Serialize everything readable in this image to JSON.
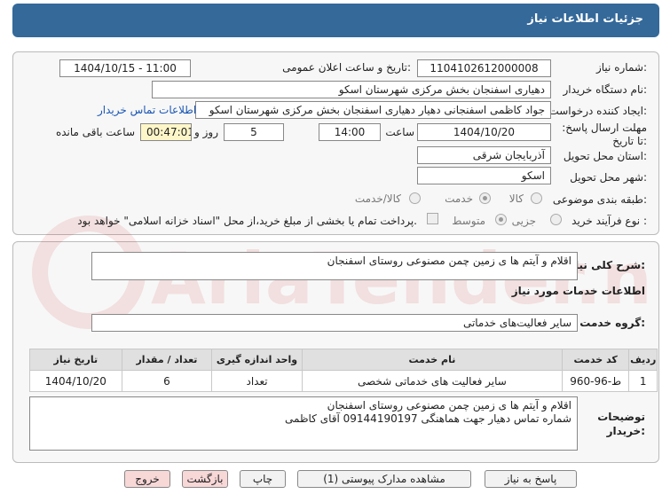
{
  "header": {
    "title": "جزئیات اطلاعات نیاز"
  },
  "fields": {
    "need_number_label": "شماره نیاز:",
    "need_number": "1104102612000008",
    "announce_label": "تاریخ و ساعت اعلان عمومی:",
    "announce_value": "1404/10/15 - 11:00",
    "buyer_label": "نام دستگاه خریدار:",
    "buyer_value": "دهیاری اسفنجان بخش مرکزی شهرستان اسکو",
    "creator_label": "ایجاد کننده درخواست:",
    "creator_value": "جواد کاظمی اسفنجانی دهیار دهیاری اسفنجان بخش مرکزی شهرستان اسکو",
    "contact_link": "اطلاعات تماس خریدار",
    "deadline_label": "مهلت ارسال پاسخ: تا تاریخ:",
    "deadline_date": "1404/10/20",
    "time_label": "ساعت",
    "deadline_time": "14:00",
    "days_value": "5",
    "days_label": "روز و",
    "remaining_time": "00:47:01",
    "remaining_label": "ساعت باقی مانده",
    "province_label": "استان محل تحویل:",
    "province_value": "آذربایجان شرقی",
    "city_label": "شهر محل تحویل:",
    "city_value": "اسکو",
    "category_label": "طبقه بندی موضوعی:",
    "category_options": [
      "کالا",
      "خدمت",
      "کالا/خدمت"
    ],
    "process_label": "نوع فرآیند خرید :",
    "process_options": [
      "جزیی",
      "متوسط"
    ],
    "process_note": "پرداخت تمام یا بخشی از مبلغ خرید،از محل \"اسناد خزانه اسلامی\" خواهد بود."
  },
  "section2": {
    "desc_label": "شرح کلی نیاز:",
    "desc_value": "اقلام و آیتم ها ی زمین چمن مصنوعی روستای اسفنجان",
    "services_title": "اطلاعات خدمات مورد نیاز",
    "group_label": "گروه خدمت:",
    "group_value": "سایر فعالیت‌های خدماتی",
    "table_headers": [
      "ردیف",
      "کد خدمت",
      "نام خدمت",
      "واحد اندازه گیری",
      "تعداد / مقدار",
      "تاریخ نیاز"
    ],
    "rows": [
      [
        "1",
        "ط-96-960",
        "سایر فعالیت های خدماتی شخصی",
        "تعداد",
        "6",
        "1404/10/20"
      ]
    ],
    "buyer_notes_label": "توضیحات خریدار:",
    "buyer_notes_line1": "اقلام و آیتم ها ی زمین چمن مصنوعی روستای اسفنجان",
    "buyer_notes_line2": "شماره تماس دهیار جهت هماهنگی 09144190197 آقای کاظمی"
  },
  "buttons": {
    "reply": "پاسخ به نیاز",
    "attachments": "مشاهده مدارک پیوستی (1)",
    "print": "چاپ",
    "back": "بازگشت",
    "exit": "خروج"
  },
  "watermark": "AriaTender.net"
}
